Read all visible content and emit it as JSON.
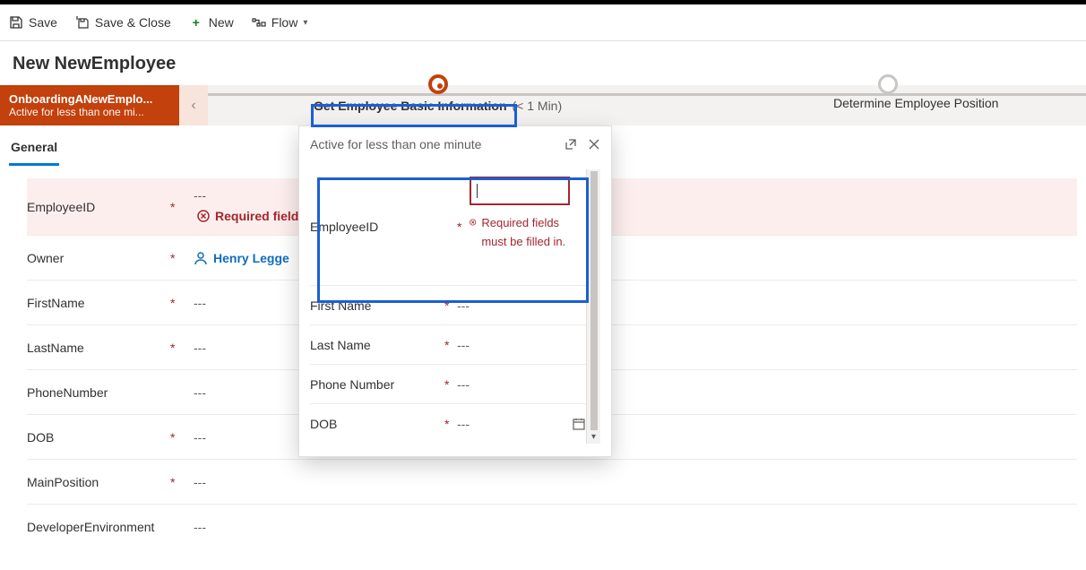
{
  "cmd": {
    "save": "Save",
    "saveclose": "Save & Close",
    "new": "New",
    "flow": "Flow"
  },
  "page_title": "New NewEmployee",
  "bpf": {
    "proc_name": "OnboardingANewEmplo...",
    "proc_sub": "Active for less than one mi...",
    "stage_a": "Get Employee Basic Information",
    "stage_a_dur": "(< 1 Min)",
    "stage_b": "Determine Employee Position"
  },
  "tab_general": "General",
  "form": {
    "empid_label": "EmployeeID",
    "empid_val": "---",
    "empid_err": "Required fields",
    "owner_label": "Owner",
    "owner_val": "Henry Legge",
    "first_label": "FirstName",
    "first_val": "---",
    "last_label": "LastName",
    "last_val": "---",
    "phone_label": "PhoneNumber",
    "phone_val": "---",
    "dob_label": "DOB",
    "dob_val": "---",
    "mainpos_label": "MainPosition",
    "mainpos_val": "---",
    "devenv_label": "DeveloperEnvironment",
    "devenv_val": "---"
  },
  "flyout": {
    "header": "Active for less than one minute",
    "empid_label": "EmployeeID",
    "err_msg": "Required fields must be filled in.",
    "first_label": "First Name",
    "first_val": "---",
    "last_label": "Last Name",
    "last_val": "---",
    "phone_label": "Phone Number",
    "phone_val": "---",
    "dob_label": "DOB",
    "dob_val": "---"
  }
}
